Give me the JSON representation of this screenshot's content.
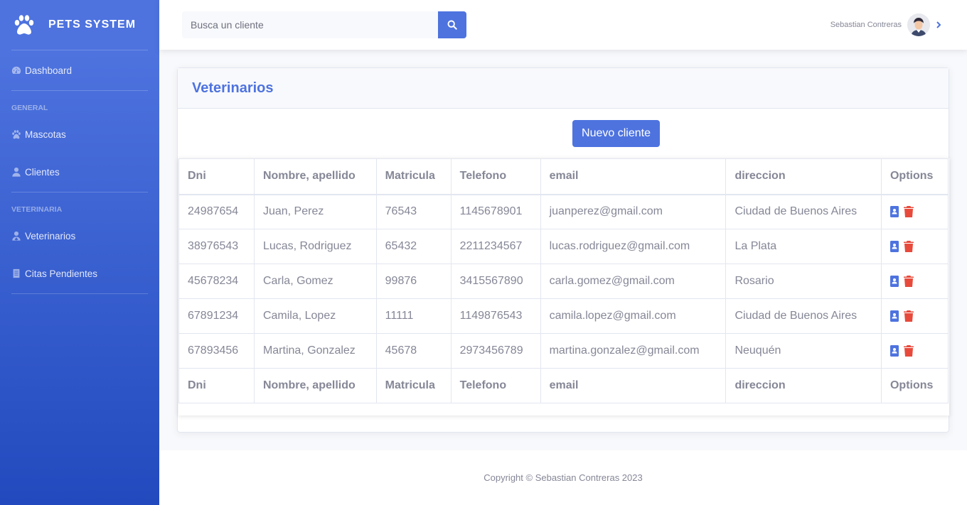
{
  "brand": {
    "name": "PETS SYSTEM",
    "icon": "paw-icon"
  },
  "sidebar": {
    "items": [
      {
        "label": "Dashboard",
        "icon": "tachometer-icon"
      },
      {
        "heading": "GENERAL"
      },
      {
        "label": "Mascotas",
        "icon": "paw-icon"
      },
      {
        "label": "Clientes",
        "icon": "user-icon"
      },
      {
        "heading": "VETERINARIA"
      },
      {
        "label": "Veterinarios",
        "icon": "user-doctor-icon"
      },
      {
        "label": "Citas Pendientes",
        "icon": "list-icon"
      }
    ]
  },
  "search": {
    "placeholder": "Busca un cliente",
    "value": ""
  },
  "user": {
    "name": "Sebastian Contreras"
  },
  "card": {
    "title": "Veterinarios",
    "new_button": "Nuevo cliente"
  },
  "table": {
    "columns": [
      "Dni",
      "Nombre, apellido",
      "Matricula",
      "Telefono",
      "email",
      "direccion",
      "Options"
    ],
    "rows": [
      [
        "24987654",
        "Juan, Perez",
        "76543",
        "1145678901",
        "juanperez@gmail.com",
        "Ciudad de Buenos Aires"
      ],
      [
        "38976543",
        "Lucas, Rodriguez",
        "65432",
        "2211234567",
        "lucas.rodriguez@gmail.com",
        "La Plata"
      ],
      [
        "45678234",
        "Carla, Gomez",
        "99876",
        "3415567890",
        "carla.gomez@gmail.com",
        "Rosario"
      ],
      [
        "67891234",
        "Camila, Lopez",
        "11111",
        "1149876543",
        "camila.lopez@gmail.com",
        "Ciudad de Buenos Aires"
      ],
      [
        "67893456",
        "Martina, Gonzalez",
        "45678",
        "2973456789",
        "martina.gonzalez@gmail.com",
        "Neuquén"
      ]
    ]
  },
  "footer": {
    "text": "Copyright © Sebastian Contreras 2023"
  },
  "colors": {
    "primary": "#4e73df",
    "danger": "#e74a3b",
    "text": "#858796"
  }
}
